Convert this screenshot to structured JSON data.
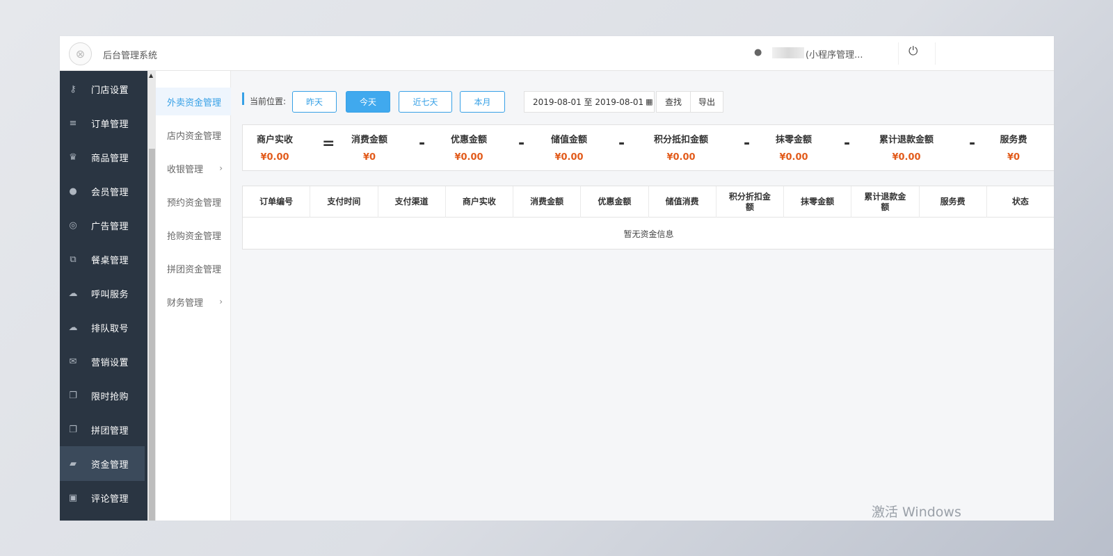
{
  "header": {
    "title": "后台管理系统",
    "user_name": "(小程序管理...",
    "logo_icon": "logo-icon",
    "power_icon": "power-icon"
  },
  "sidebar": {
    "items": [
      {
        "label": "门店设置",
        "icon": "key-icon",
        "glyph": "⚷"
      },
      {
        "label": "订单管理",
        "icon": "list-icon",
        "glyph": "≡"
      },
      {
        "label": "商品管理",
        "icon": "trophy-icon",
        "glyph": "♛"
      },
      {
        "label": "会员管理",
        "icon": "user-icon",
        "glyph": "●"
      },
      {
        "label": "广告管理",
        "icon": "lifebuoy-icon",
        "glyph": "◎"
      },
      {
        "label": "餐桌管理",
        "icon": "binoculars-icon",
        "glyph": "⧉"
      },
      {
        "label": "呼叫服务",
        "icon": "cloud-icon",
        "glyph": "☁"
      },
      {
        "label": "排队取号",
        "icon": "cloud-icon",
        "glyph": "☁"
      },
      {
        "label": "营销设置",
        "icon": "gift-icon",
        "glyph": "✉"
      },
      {
        "label": "限时抢购",
        "icon": "copy-icon",
        "glyph": "❐"
      },
      {
        "label": "拼团管理",
        "icon": "copy-icon",
        "glyph": "❐"
      },
      {
        "label": "资金管理",
        "icon": "book-icon",
        "glyph": "▰"
      },
      {
        "label": "评论管理",
        "icon": "money-icon",
        "glyph": "▣"
      }
    ],
    "active_index": 11
  },
  "submenu": {
    "items": [
      {
        "label": "外卖资金管理",
        "has_arrow": false
      },
      {
        "label": "店内资金管理",
        "has_arrow": false
      },
      {
        "label": "收银管理",
        "has_arrow": true
      },
      {
        "label": "预约资金管理",
        "has_arrow": false
      },
      {
        "label": "抢购资金管理",
        "has_arrow": false
      },
      {
        "label": "拼团资金管理",
        "has_arrow": false
      },
      {
        "label": "财务管理",
        "has_arrow": true
      }
    ],
    "active_index": 0,
    "arrow": "›"
  },
  "filter": {
    "breadcrumb_label": "当前位置:",
    "buttons": [
      "昨天",
      "今天",
      "近七天",
      "本月"
    ],
    "active_index": 1,
    "date_range": "2019-08-01 至 2019-08-01",
    "calendar_icon": "calendar-icon",
    "search_label": "查找",
    "export_label": "导出"
  },
  "summary": {
    "items": [
      {
        "label": "商户实收",
        "value": "¥0.00"
      },
      {
        "label": "消费金额",
        "value": "¥0"
      },
      {
        "label": "优惠金额",
        "value": "¥0.00"
      },
      {
        "label": "储值金额",
        "value": "¥0.00"
      },
      {
        "label": "积分抵扣金额",
        "value": "¥0.00"
      },
      {
        "label": "抹零金额",
        "value": "¥0.00"
      },
      {
        "label": "累计退款金额",
        "value": "¥0.00"
      },
      {
        "label": "服务费",
        "value": "¥0"
      }
    ],
    "operators": [
      "=",
      "-",
      "-",
      "-",
      "-",
      "-",
      "-"
    ]
  },
  "table": {
    "columns": [
      "订单编号",
      "支付时间",
      "支付渠道",
      "商户实收",
      "消费金额",
      "优惠金额",
      "储值消费",
      "积分折扣金额",
      "抹零金额",
      "累计退款金额",
      "服务费",
      "状态"
    ],
    "empty_text": "暂无资金信息"
  },
  "watermark": "激活 Windows",
  "colors": {
    "accent": "#36a0e6",
    "sidebar_bg": "#2a3542",
    "sidebar_active": "#3b4a5b",
    "money": "#e25b1b"
  }
}
